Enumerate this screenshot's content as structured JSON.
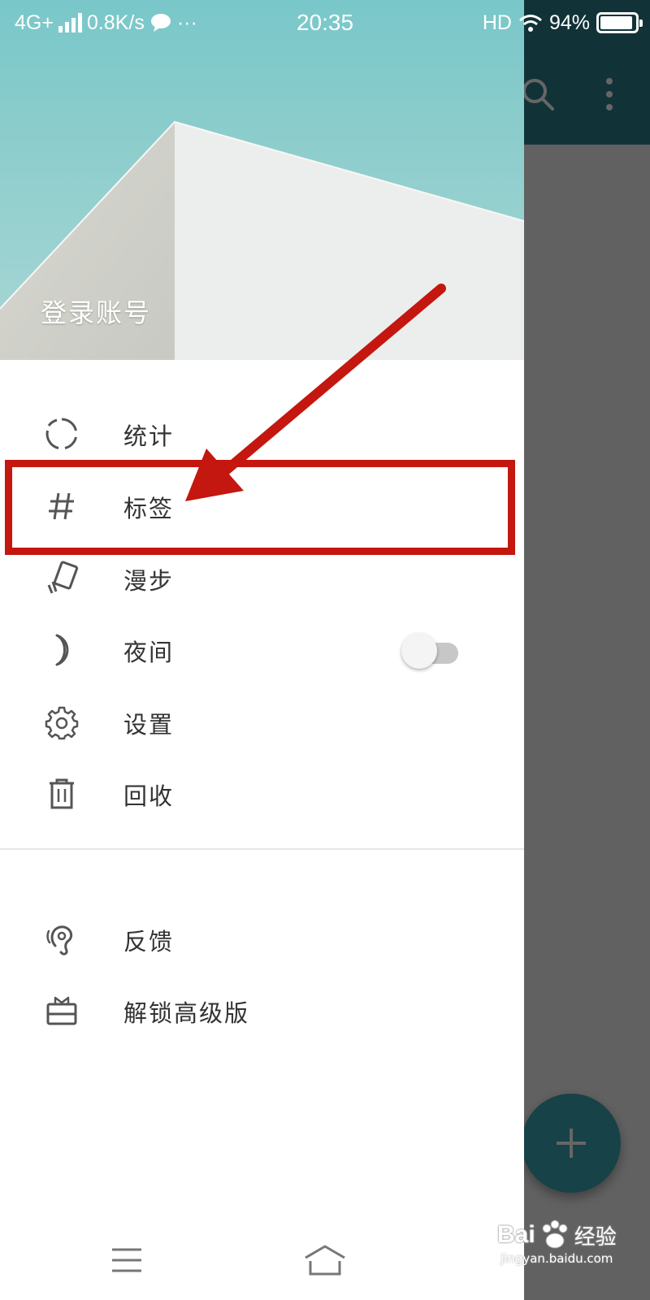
{
  "status_bar": {
    "network": "4G+",
    "speed": "0.8K/s",
    "more": "···",
    "time": "20:35",
    "hd": "HD",
    "battery_percent": "94%",
    "battery_level": 0.94
  },
  "drawer": {
    "login_label": "登录账号",
    "items": [
      {
        "label": "统计",
        "icon": "stats-ring-icon"
      },
      {
        "label": "标签",
        "icon": "hash-icon"
      },
      {
        "label": "漫步",
        "icon": "wander-card-icon"
      },
      {
        "label": "夜间",
        "icon": "moon-icon",
        "toggle": false
      },
      {
        "label": "设置",
        "icon": "gear-icon"
      },
      {
        "label": "回收",
        "icon": "trash-icon"
      }
    ],
    "secondary_items": [
      {
        "label": "反馈",
        "icon": "ear-feedback-icon"
      },
      {
        "label": "解锁高级版",
        "icon": "gift-icon"
      }
    ]
  },
  "colors": {
    "accent": "#2b7f8c",
    "fab": "#3aa5b2",
    "annotation": "#c4170f"
  },
  "watermark": {
    "brand": "Bai",
    "cn": "经验",
    "url": "jingyan.baidu.com"
  }
}
